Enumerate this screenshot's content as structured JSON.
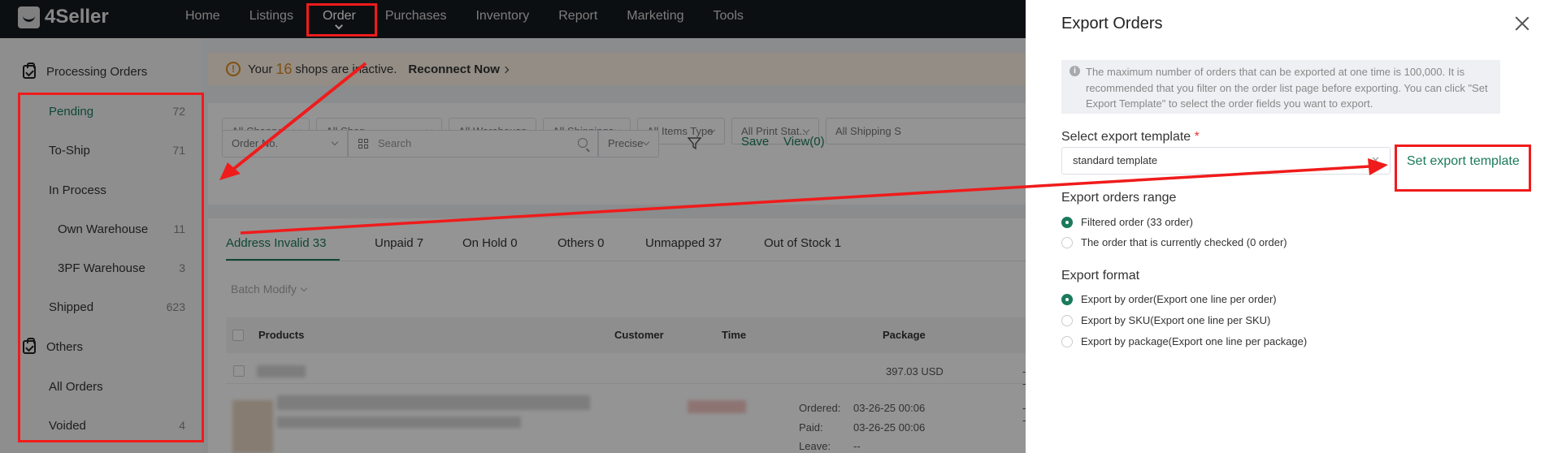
{
  "app": {
    "brand": "4Seller"
  },
  "nav": {
    "items": [
      {
        "label": "Home"
      },
      {
        "label": "Listings"
      },
      {
        "label": "Order",
        "active": true
      },
      {
        "label": "Purchases"
      },
      {
        "label": "Inventory"
      },
      {
        "label": "Report"
      },
      {
        "label": "Marketing"
      },
      {
        "label": "Tools"
      }
    ]
  },
  "sidebar": {
    "group1": "Processing Orders",
    "pending": {
      "label": "Pending",
      "count": "72"
    },
    "to_ship": {
      "label": "To-Ship",
      "count": "71"
    },
    "in_process": {
      "label": "In Process"
    },
    "own_warehouse": {
      "label": "Own Warehouse",
      "count": "11"
    },
    "tpf_warehouse": {
      "label": "3PF Warehouse",
      "count": "3"
    },
    "shipped": {
      "label": "Shipped",
      "count": "623"
    },
    "group2": "Others",
    "all_orders": {
      "label": "All Orders"
    },
    "voided": {
      "label": "Voided",
      "count": "4"
    }
  },
  "alert": {
    "prefix": "Your",
    "count": "16",
    "suffix": "shops are inactive.",
    "action": "Reconnect Now"
  },
  "filters": {
    "channel": "All Channel",
    "shop": "All Shop",
    "warehouse": "All Warehouse",
    "shippings": "All Shippings",
    "items_type": "All Items Type",
    "print_status": "All Print Stat...",
    "shipping_status": "All Shipping S",
    "order_no": "Order No.",
    "search_placeholder": "Search",
    "match": "Precise",
    "save": "Save",
    "view": "View(0)"
  },
  "tabs": [
    {
      "label": "Address Invalid 33"
    },
    {
      "label": "Unpaid 7"
    },
    {
      "label": "On Hold 0"
    },
    {
      "label": "Others 0"
    },
    {
      "label": "Unmapped 37"
    },
    {
      "label": "Out of Stock 1"
    }
  ],
  "table": {
    "batch_modify": "Batch Modify",
    "headers": {
      "products": "Products",
      "customer": "Customer",
      "time": "Time",
      "package": "Package"
    },
    "row1": {
      "amount": "397.03 USD",
      "package": "--"
    },
    "row2": {
      "ordered_label": "Ordered:",
      "ordered": "03-26-25 00:06",
      "paid_label": "Paid:",
      "paid": "03-26-25 00:06",
      "leave_label": "Leave:",
      "leave": "--",
      "package": "--"
    }
  },
  "drawer": {
    "title": "Export Orders",
    "info": "The maximum number of orders that can be exported at one time is 100,000. It is recommended that you filter on the order list page before exporting. You can click \"Set Export Template\" to select the order fields you want to export.",
    "template_label": "Select export template",
    "template_required": "*",
    "template_value": "standard template",
    "set_template": "Set export template",
    "range_label": "Export orders range",
    "range_options": [
      {
        "label": "Filtered order (33 order)",
        "checked": true
      },
      {
        "label": "The order that is currently checked (0 order)",
        "checked": false
      }
    ],
    "format_label": "Export format",
    "format_options": [
      {
        "label": "Export by order(Export one line per order)",
        "checked": true
      },
      {
        "label": "Export by SKU(Export one line per SKU)",
        "checked": false
      },
      {
        "label": "Export by package(Export one line per package)",
        "checked": false
      }
    ]
  },
  "colors": {
    "accent": "#1a7a5c",
    "annotation": "#f01b1b",
    "warning": "#e08a1e"
  }
}
